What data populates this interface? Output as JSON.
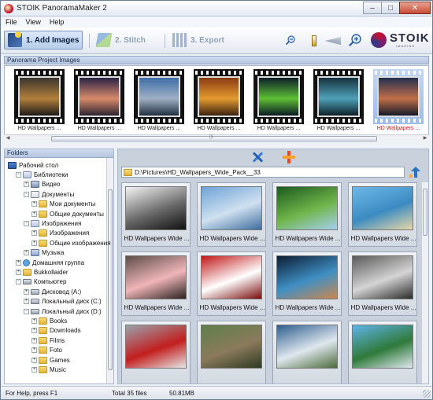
{
  "window": {
    "title": "STOIK PanoramaMaker 2"
  },
  "menu": [
    "File",
    "View",
    "Help"
  ],
  "toolbar": {
    "steps": [
      {
        "label": "1. Add Images",
        "state": "active"
      },
      {
        "label": "2. Stitch",
        "state": "disabled"
      },
      {
        "label": "3. Export",
        "state": "disabled"
      }
    ],
    "zoom_level": 0.1,
    "logo": {
      "word": "STOIK",
      "sub": "IMAGING"
    }
  },
  "project_panel": {
    "title": "Panorama Project Images",
    "items": [
      {
        "caption": "HD Wallpapers ...",
        "colors": [
          "#3a3530",
          "#b2803b",
          "#1d1a18"
        ],
        "selected": false
      },
      {
        "caption": "HD Wallpapers ...",
        "colors": [
          "#2a2346",
          "#d98a6a",
          "#2b2430"
        ],
        "selected": false
      },
      {
        "caption": "HD Wallpapers ...",
        "colors": [
          "#3f6ea8",
          "#9fb0c4",
          "#203040"
        ],
        "selected": false
      },
      {
        "caption": "HD Wallpapers ...",
        "colors": [
          "#8a3b12",
          "#e49a2f",
          "#3a220f"
        ],
        "selected": false
      },
      {
        "caption": "HD Wallpapers ...",
        "colors": [
          "#0c1f2a",
          "#5fbf36",
          "#0b1a22"
        ],
        "selected": false
      },
      {
        "caption": "HD Wallpapers ...",
        "colors": [
          "#16313f",
          "#4fa1b7",
          "#0d2028"
        ],
        "selected": false
      },
      {
        "caption": "HD Wallpapers ...",
        "colors": [
          "#23304e",
          "#c26f4a",
          "#141a2a"
        ],
        "selected": true
      }
    ]
  },
  "folders": {
    "title": "Folders",
    "tree": [
      {
        "label": "Рабочий стол",
        "level": 0,
        "expander": "",
        "icon": "desk"
      },
      {
        "label": "Библиотеки",
        "level": 1,
        "expander": "-",
        "icon": "lib"
      },
      {
        "label": "Видео",
        "level": 2,
        "expander": "+",
        "icon": "video"
      },
      {
        "label": "Документы",
        "level": 2,
        "expander": "-",
        "icon": "doc"
      },
      {
        "label": "Мои документы",
        "level": 3,
        "expander": "+",
        "icon": "folder"
      },
      {
        "label": "Общие документы",
        "level": 3,
        "expander": "+",
        "icon": "folder"
      },
      {
        "label": "Изображения",
        "level": 2,
        "expander": "-",
        "icon": "lib"
      },
      {
        "label": "Изображения",
        "level": 3,
        "expander": "+",
        "icon": "folder"
      },
      {
        "label": "Общие изображения",
        "level": 3,
        "expander": "+",
        "icon": "folder"
      },
      {
        "label": "Музыка",
        "level": 2,
        "expander": "+",
        "icon": "music"
      },
      {
        "label": "Домашняя группа",
        "level": 1,
        "expander": "+",
        "icon": "group"
      },
      {
        "label": "Bukkollaider",
        "level": 1,
        "expander": "+",
        "icon": "folder"
      },
      {
        "label": "Компьютер",
        "level": 1,
        "expander": "-",
        "icon": "drive"
      },
      {
        "label": "Дисковод (A:)",
        "level": 2,
        "expander": "+",
        "icon": "drive"
      },
      {
        "label": "Локальный диск (C:)",
        "level": 2,
        "expander": "+",
        "icon": "drive"
      },
      {
        "label": "Локальный диск (D:)",
        "level": 2,
        "expander": "-",
        "icon": "drive"
      },
      {
        "label": "Books",
        "level": 3,
        "expander": "+",
        "icon": "folder"
      },
      {
        "label": "Downloads",
        "level": 3,
        "expander": "+",
        "icon": "folder"
      },
      {
        "label": "Films",
        "level": 3,
        "expander": "+",
        "icon": "folder"
      },
      {
        "label": "Foto",
        "level": 3,
        "expander": "+",
        "icon": "folder"
      },
      {
        "label": "Games",
        "level": 3,
        "expander": "+",
        "icon": "folder"
      },
      {
        "label": "Music",
        "level": 3,
        "expander": "+",
        "icon": "folder"
      }
    ]
  },
  "browser": {
    "path": "D:\\Pictures\\HD_Wallpapers_Wide_Pack__33",
    "thumbnails": [
      {
        "label": "HD Wallpapers Wide ...",
        "colors": [
          "#f4f4f4",
          "#6a6a6a",
          "#111111"
        ]
      },
      {
        "label": "HD Wallpapers Wide ...",
        "colors": [
          "#6fa3d6",
          "#cfe0f0",
          "#3d6e9e"
        ]
      },
      {
        "label": "HD Wallpapers Wide ...",
        "colors": [
          "#1d5a1f",
          "#6fb54a",
          "#a5d0f0"
        ]
      },
      {
        "label": "HD Wallpapers Wide ...",
        "colors": [
          "#6fb8e8",
          "#3b8bc2",
          "#e8d8a8"
        ]
      },
      {
        "label": "HD Wallpapers Wide ...",
        "colors": [
          "#5c4d49",
          "#f0b5b8",
          "#2a2220"
        ]
      },
      {
        "label": "HD Wallpapers Wide ...",
        "colors": [
          "#c01818",
          "#ffffff",
          "#7a0b0b"
        ]
      },
      {
        "label": "HD Wallpapers Wide ...",
        "colors": [
          "#0d1d33",
          "#3f8fc4",
          "#c9884f"
        ]
      },
      {
        "label": "HD Wallpapers Wide ...",
        "colors": [
          "#5a5a5a",
          "#d4d4d4",
          "#2a2a2a"
        ]
      },
      {
        "label": "",
        "colors": [
          "#9aa3ac",
          "#c21e1e",
          "#e6e6e6"
        ]
      },
      {
        "label": "",
        "colors": [
          "#5f7f4a",
          "#8b7a5c",
          "#2e3a22"
        ]
      },
      {
        "label": "",
        "colors": [
          "#2f5e8f",
          "#dfe7ee",
          "#4b6b3a"
        ]
      },
      {
        "label": "",
        "colors": [
          "#5fb3e8",
          "#2f7a3a",
          "#e0e8f0"
        ]
      }
    ]
  },
  "status": {
    "help": "For Help, press F1",
    "total": "Total 35 files",
    "size": "50.81MB"
  }
}
